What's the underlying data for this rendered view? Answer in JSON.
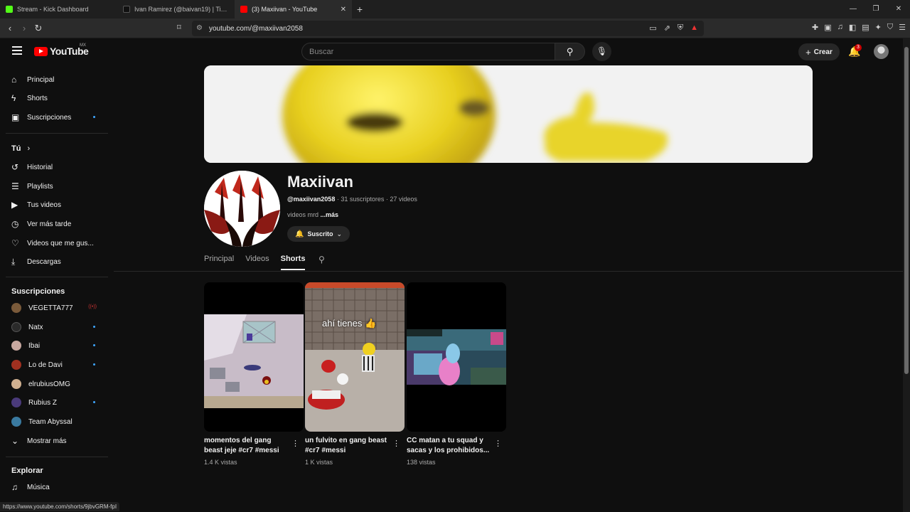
{
  "browser": {
    "tabs": [
      {
        "label": "Stream - Kick Dashboard",
        "color": "#53fc18"
      },
      {
        "label": "Ivan Ramirez (@baivan19) | TikTok",
        "color": "#222222"
      },
      {
        "label": "(3) Maxiivan - YouTube",
        "color": "#ff0000"
      }
    ],
    "url": "youtube.com/@maxiivan2058",
    "status_url": "https://www.youtube.com/shorts/9jbvGRM-fpI"
  },
  "header": {
    "logo_text": "YouTube",
    "region": "MX",
    "search_placeholder": "Buscar",
    "create_label": "Crear",
    "notification_count": "3"
  },
  "sidebar": {
    "main": [
      {
        "label": "Principal",
        "icon": "home-icon",
        "glyph": "⌂"
      },
      {
        "label": "Shorts",
        "icon": "shorts-icon",
        "glyph": "⚡"
      },
      {
        "label": "Suscripciones",
        "icon": "subscriptions-icon",
        "glyph": "▣"
      }
    ],
    "you_header": "Tú",
    "you": [
      {
        "label": "Historial",
        "icon": "history-icon",
        "glyph": "↺"
      },
      {
        "label": "Playlists",
        "icon": "playlists-icon",
        "glyph": "☰"
      },
      {
        "label": "Tus videos",
        "icon": "your-videos-icon",
        "glyph": "▶"
      },
      {
        "label": "Ver más tarde",
        "icon": "watch-later-icon",
        "glyph": "◷"
      },
      {
        "label": "Videos que me gus...",
        "icon": "like-icon",
        "glyph": "👍"
      },
      {
        "label": "Descargas",
        "icon": "download-icon",
        "glyph": "⤓"
      }
    ],
    "subs_header": "Suscripciones",
    "subs": [
      {
        "label": "VEGETTA777",
        "color": "#7a5a3a"
      },
      {
        "label": "Natx",
        "color": "#2a2a2a"
      },
      {
        "label": "Ibai",
        "color": "#c8a8a0"
      },
      {
        "label": "Lo de Davi",
        "color": "#a03020"
      },
      {
        "label": "elrubiusOMG",
        "color": "#d0b090"
      },
      {
        "label": "Rubius Z",
        "color": "#4a3a7a"
      },
      {
        "label": "Team Abyssal",
        "color": "#3a7aa0"
      }
    ],
    "show_more": "Mostrar más",
    "explore_header": "Explorar",
    "explore": [
      {
        "label": "Música",
        "icon": "music-icon",
        "glyph": "♫"
      }
    ]
  },
  "channel": {
    "name": "Maxiivan",
    "handle": "@maxiivan2058",
    "meta": " · 31 suscriptores · 27 videos",
    "description": "videos mrd ",
    "more": "...más",
    "subscribe_label": "Suscrito",
    "tabs": [
      "Principal",
      "Videos",
      "Shorts"
    ]
  },
  "shorts": [
    {
      "title": "momentos del gang beast jeje #cr7 #messi",
      "views": "1.4 K vistas"
    },
    {
      "title": "un fulvito en gang beast #cr7 #messi",
      "views": "1 K vistas",
      "overlay": "ahí tienes 👍"
    },
    {
      "title": "CC matan a tu squad y sacas y los prohibidos...",
      "views": "138 vistas"
    }
  ]
}
